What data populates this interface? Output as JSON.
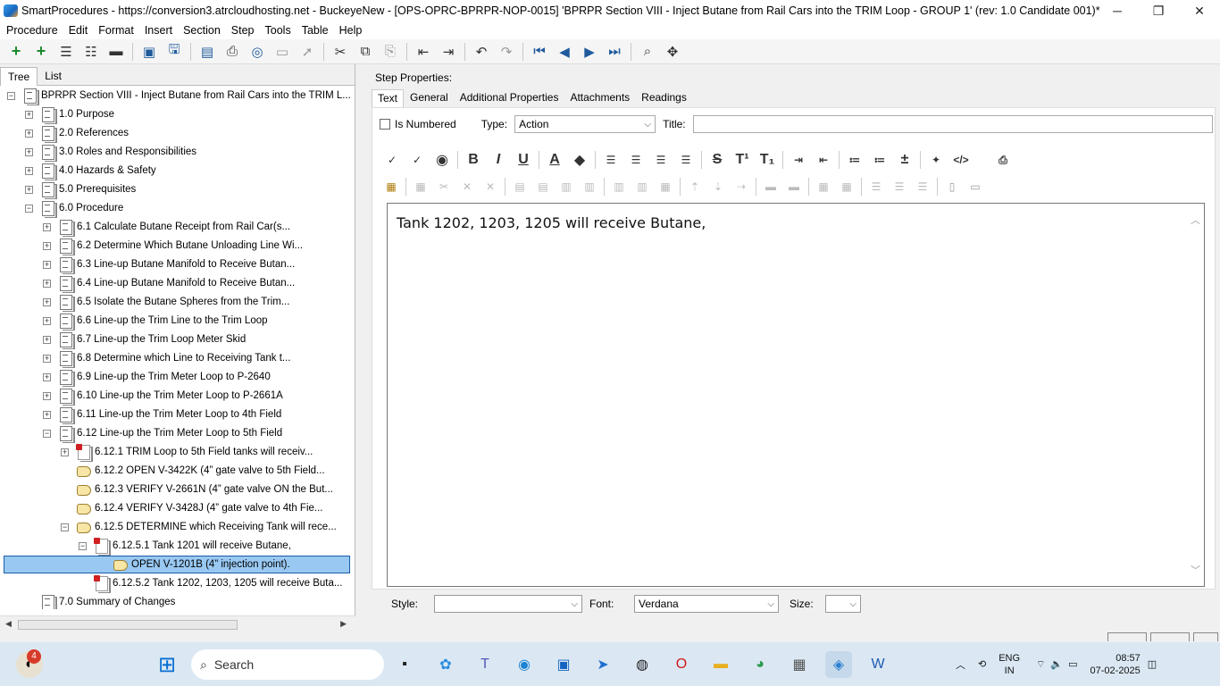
{
  "window": {
    "title": "SmartProcedures - https://conversion3.atrcloudhosting.net - BuckeyeNew - [OPS-OPRC-BPRPR-NOP-0015] 'BPRPR Section VIII - Inject Butane from Rail Cars into the TRIM Loop - GROUP 1' (rev: 1.0 Candidate 001)*",
    "minimize": "─",
    "maximize": "❐",
    "close": "✕"
  },
  "menu": [
    "Procedure",
    "Edit",
    "Format",
    "Insert",
    "Section",
    "Step",
    "Tools",
    "Table",
    "Help"
  ],
  "left_tabs": [
    "Tree",
    "List"
  ],
  "tree": [
    {
      "label": "BPRPR Section VIII - Inject Butane from Rail Cars into the TRIM L...",
      "indent": 0,
      "exp": "−",
      "icon": "doc"
    },
    {
      "label": "1.0 Purpose",
      "indent": 1,
      "exp": "+",
      "icon": "doc"
    },
    {
      "label": "2.0 References",
      "indent": 1,
      "exp": "+",
      "icon": "doc"
    },
    {
      "label": "3.0 Roles and Responsibilities",
      "indent": 1,
      "exp": "+",
      "icon": "doc"
    },
    {
      "label": "4.0 Hazards & Safety",
      "indent": 1,
      "exp": "+",
      "icon": "doc"
    },
    {
      "label": "5.0 Prerequisites",
      "indent": 1,
      "exp": "+",
      "icon": "doc"
    },
    {
      "label": "6.0 Procedure",
      "indent": 1,
      "exp": "−",
      "icon": "doc"
    },
    {
      "label": "6.1 Calculate Butane Receipt from Rail Car(s...",
      "indent": 2,
      "exp": "+",
      "icon": "doc"
    },
    {
      "label": "6.2 Determine Which Butane Unloading Line Wi...",
      "indent": 2,
      "exp": "+",
      "icon": "doc"
    },
    {
      "label": "6.3 Line-up Butane Manifold to Receive Butan...",
      "indent": 2,
      "exp": "+",
      "icon": "doc"
    },
    {
      "label": "6.4 Line-up Butane Manifold to Receive Butan...",
      "indent": 2,
      "exp": "+",
      "icon": "doc"
    },
    {
      "label": "6.5 Isolate the Butane Spheres from the Trim...",
      "indent": 2,
      "exp": "+",
      "icon": "doc"
    },
    {
      "label": "6.6 Line-up the Trim Line to the Trim Loop",
      "indent": 2,
      "exp": "+",
      "icon": "doc"
    },
    {
      "label": "6.7 Line-up the Trim Loop Meter Skid",
      "indent": 2,
      "exp": "+",
      "icon": "doc"
    },
    {
      "label": "6.8 Determine which Line to Receiving Tank t...",
      "indent": 2,
      "exp": "+",
      "icon": "doc"
    },
    {
      "label": "6.9 Line-up the Trim Meter Loop to P-2640",
      "indent": 2,
      "exp": "+",
      "icon": "doc"
    },
    {
      "label": "6.10 Line-up the Trim Meter Loop to P-2661A",
      "indent": 2,
      "exp": "+",
      "icon": "doc"
    },
    {
      "label": "6.11 Line-up the Trim Meter Loop to 4th Field",
      "indent": 2,
      "exp": "+",
      "icon": "doc"
    },
    {
      "label": "6.12 Line-up the Trim Meter Loop to 5th Field",
      "indent": 2,
      "exp": "−",
      "icon": "doc"
    },
    {
      "label": "6.12.1 TRIM Loop to 5th Field tanks will receiv...",
      "indent": 3,
      "exp": "+",
      "icon": "red"
    },
    {
      "label": "6.12.2 OPEN V-3422K (4” gate valve to 5th Field...",
      "indent": 3,
      "exp": "",
      "icon": "hand"
    },
    {
      "label": "6.12.3 VERIFY V-2661N (4” gate valve ON the But...",
      "indent": 3,
      "exp": "",
      "icon": "hand"
    },
    {
      "label": "6.12.4 VERIFY V-3428J (4” gate valve to 4th Fie...",
      "indent": 3,
      "exp": "",
      "icon": "hand"
    },
    {
      "label": "6.12.5 DETERMINE which Receiving Tank will rece...",
      "indent": 3,
      "exp": "−",
      "icon": "hand"
    },
    {
      "label": "6.12.5.1 Tank 1201 will receive Butane,",
      "indent": 4,
      "exp": "−",
      "icon": "red"
    },
    {
      "label": "OPEN V-1201B (4” injection point).",
      "indent": 5,
      "exp": "",
      "icon": "hand",
      "selected": true
    },
    {
      "label": "6.12.5.2 Tank 1202, 1203, 1205 will receive Buta...",
      "indent": 4,
      "exp": "",
      "icon": "red"
    },
    {
      "label": "7.0 Summary of Changes",
      "indent": 1,
      "exp": "",
      "icon": "doc"
    }
  ],
  "right": {
    "step_properties_label": "Step Properties:",
    "tabs": [
      "Text",
      "General",
      "Additional Properties",
      "Attachments",
      "Readings"
    ],
    "is_numbered_label": "Is Numbered",
    "type_label": "Type:",
    "type_value": "Action",
    "title_label": "Title:",
    "editor_text": "Tank 1202, 1203, 1205 will receive Butane,",
    "style_label": "Style:",
    "style_value": "",
    "font_label": "Font:",
    "font_value": "Verdana",
    "size_label": "Size:",
    "size_value": ""
  },
  "taskbar": {
    "search_label": "Search",
    "notification_badge": "4",
    "lang_line1": "ENG",
    "lang_line2": "IN",
    "time": "08:57",
    "date": "07-02-2025"
  }
}
